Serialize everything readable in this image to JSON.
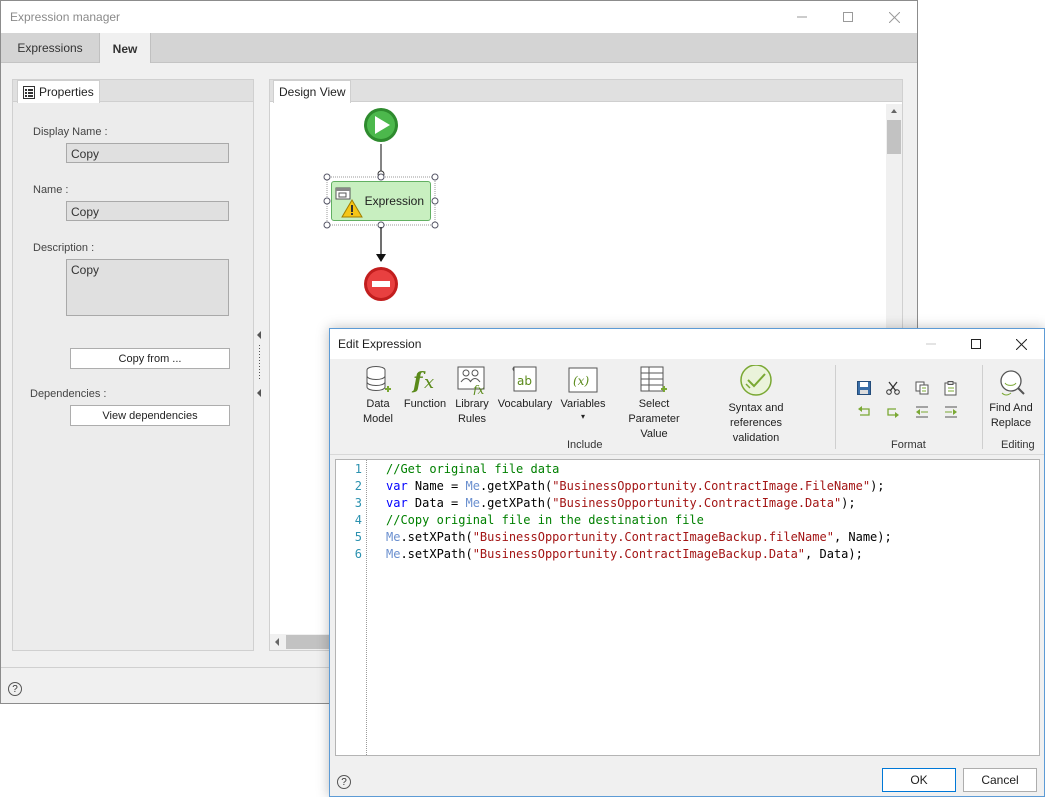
{
  "manager": {
    "title": "Expression manager",
    "tabs": [
      {
        "label": "Expressions"
      },
      {
        "label": "New"
      }
    ],
    "properties": {
      "tab_label": "Properties",
      "display_name_label": "Display Name :",
      "display_name_value": "Copy",
      "name_label": "Name :",
      "name_value": "Copy",
      "description_label": "Description :",
      "description_value": "Copy",
      "copy_from_label": "Copy from ...",
      "dependencies_label": "Dependencies :",
      "view_dependencies_label": "View dependencies"
    },
    "design_view": {
      "tab_label": "Design View",
      "expression_node_label": "Expression"
    }
  },
  "editor_dialog": {
    "title": "Edit Expression",
    "ribbon": {
      "include_buttons": [
        {
          "line1": "Data",
          "line2": "Model",
          "icon": "database-icon"
        },
        {
          "line1": "Function",
          "line2": "",
          "icon": "function-icon"
        },
        {
          "line1": "Library",
          "line2": "Rules",
          "icon": "library-rules-icon"
        },
        {
          "line1": "Vocabulary",
          "line2": "",
          "icon": "vocabulary-icon"
        },
        {
          "line1": "Variables",
          "line2": "▾",
          "icon": "variables-icon"
        },
        {
          "line1": "Select Parameter",
          "line2": "Value",
          "icon": "select-parameter-icon"
        },
        {
          "line1": "Syntax and references",
          "line2": "validation",
          "icon": "validation-icon"
        }
      ],
      "include_group": "Include",
      "format_group": "Format",
      "editing_button": {
        "line1": "Find And",
        "line2": "Replace"
      },
      "editing_group": "Editing"
    },
    "code_lines": [
      {
        "n": "1",
        "segments": [
          {
            "cls": "cm",
            "text": "//Get original file data"
          }
        ]
      },
      {
        "n": "2",
        "segments": [
          {
            "cls": "kw",
            "text": "var"
          },
          {
            "cls": "",
            "text": " Name = "
          },
          {
            "cls": "me",
            "text": "Me"
          },
          {
            "cls": "",
            "text": ".getXPath("
          },
          {
            "cls": "str",
            "text": "\"BusinessOpportunity.ContractImage.FileName\""
          },
          {
            "cls": "",
            "text": ");"
          }
        ]
      },
      {
        "n": "3",
        "segments": [
          {
            "cls": "kw",
            "text": "var"
          },
          {
            "cls": "",
            "text": " Data = "
          },
          {
            "cls": "me",
            "text": "Me"
          },
          {
            "cls": "",
            "text": ".getXPath("
          },
          {
            "cls": "str",
            "text": "\"BusinessOpportunity.ContractImage.Data\""
          },
          {
            "cls": "",
            "text": ");"
          }
        ]
      },
      {
        "n": "4",
        "segments": [
          {
            "cls": "cm",
            "text": "//Copy original file in the destination file"
          }
        ]
      },
      {
        "n": "5",
        "segments": [
          {
            "cls": "me",
            "text": "Me"
          },
          {
            "cls": "",
            "text": ".setXPath("
          },
          {
            "cls": "str",
            "text": "\"BusinessOpportunity.ContractImageBackup.fileName\""
          },
          {
            "cls": "",
            "text": ", Name);"
          }
        ]
      },
      {
        "n": "6",
        "segments": [
          {
            "cls": "me",
            "text": "Me"
          },
          {
            "cls": "",
            "text": ".setXPath("
          },
          {
            "cls": "str",
            "text": "\"BusinessOpportunity.ContractImageBackup.Data\""
          },
          {
            "cls": "",
            "text": ", Data);"
          }
        ]
      }
    ],
    "ok_label": "OK",
    "cancel_label": "Cancel"
  },
  "help_glyph": "?"
}
